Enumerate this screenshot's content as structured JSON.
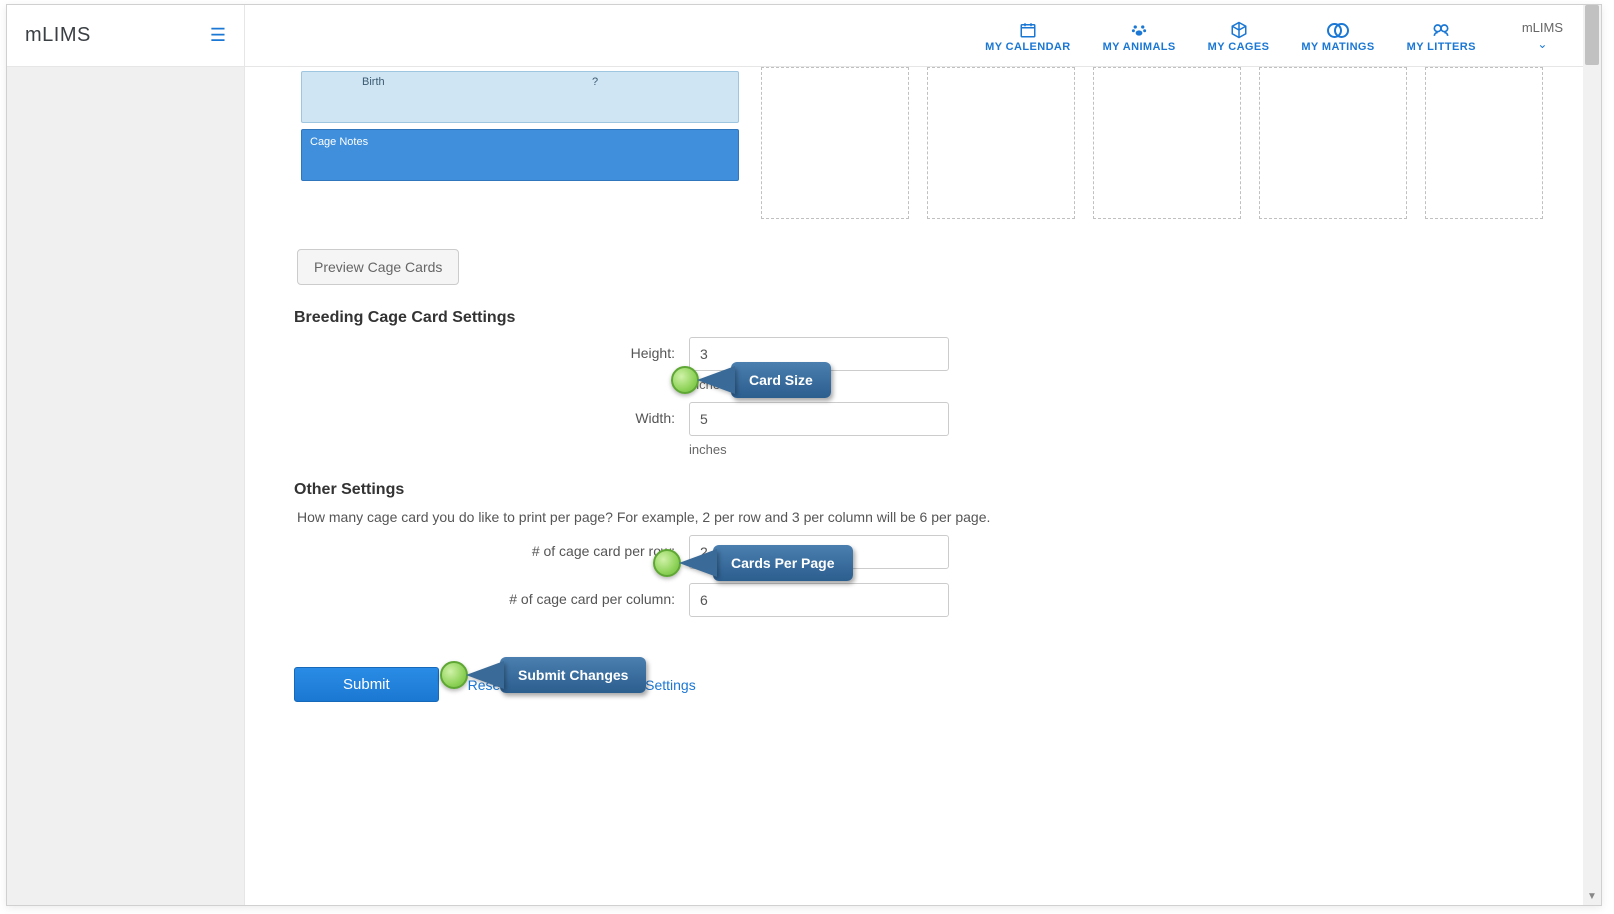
{
  "brand": "mLIMS",
  "nav": [
    {
      "label": "MY CALENDAR",
      "icon": "calendar"
    },
    {
      "label": "MY ANIMALS",
      "icon": "paw"
    },
    {
      "label": "MY CAGES",
      "icon": "cube"
    },
    {
      "label": "MY MATINGS",
      "icon": "mating"
    },
    {
      "label": "MY LITTERS",
      "icon": "litters"
    }
  ],
  "user": {
    "label": "mLIMS"
  },
  "card_preview": {
    "birth_label": "Birth",
    "question": "?",
    "notes_label": "Cage Notes"
  },
  "preview_button": "Preview Cage Cards",
  "breeding": {
    "heading": "Breeding Cage Card Settings",
    "height_label": "Height:",
    "height_value": "3",
    "height_unit": "inches",
    "width_label": "Width:",
    "width_value": "5",
    "width_unit": "inches"
  },
  "other": {
    "heading": "Other Settings",
    "desc": "How many cage card you do like to print per page? For example, 2 per row and 3 per column will be 6 per page.",
    "per_row_label": "# of cage card per row:",
    "per_row_value": "2",
    "per_col_label": "# of cage card per column:",
    "per_col_value": "6"
  },
  "actions": {
    "submit": "Submit",
    "reset": "Reset",
    "return": "Return to System Settings"
  },
  "callouts": {
    "card_size": "Card Size",
    "cards_per_page": "Cards Per Page",
    "submit_changes": "Submit Changes"
  }
}
